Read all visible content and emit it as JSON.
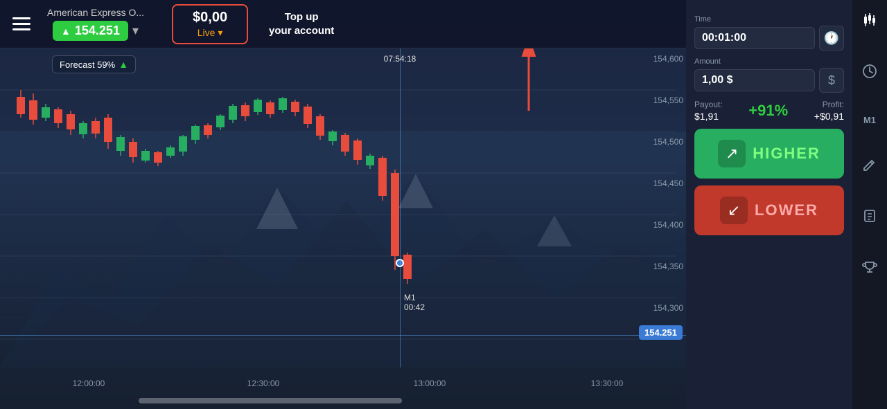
{
  "header": {
    "menu_label": "menu",
    "asset_name": "American Express O...",
    "asset_price": "154.251",
    "dropdown_label": "▾",
    "balance_amount": "$0,00",
    "balance_live_label": "Live",
    "balance_live_chevron": "▾",
    "topup_label": "Top up\nyour account"
  },
  "chart": {
    "forecast_label": "Forecast 59%",
    "forecast_arrow": "▲",
    "crosshair_time": "07:54:18",
    "annotation_m1": "M1",
    "annotation_time": "00:42",
    "price_tag": "154.251",
    "times": [
      "12:00:00",
      "12:30:00",
      "13:00:00",
      "13:30:00"
    ],
    "prices": [
      "154,600",
      "154,550",
      "154,500",
      "154,450",
      "154,400",
      "154,350",
      "154,300"
    ]
  },
  "controls": {
    "time_label": "Time",
    "time_value": "00:01:00",
    "amount_label": "Amount",
    "amount_value": "1,00 $",
    "dollar_symbol": "$",
    "payout_label": "Payout:",
    "payout_value": "$1,91",
    "payout_pct": "+91%",
    "profit_label": "Profit:",
    "profit_value": "+$0,91",
    "higher_btn_label": "HIGHER",
    "lower_btn_label": "LOWER"
  },
  "sidebar": {
    "icons": [
      "candlestick",
      "clock",
      "m1-label",
      "edit",
      "book",
      "trophy"
    ]
  }
}
